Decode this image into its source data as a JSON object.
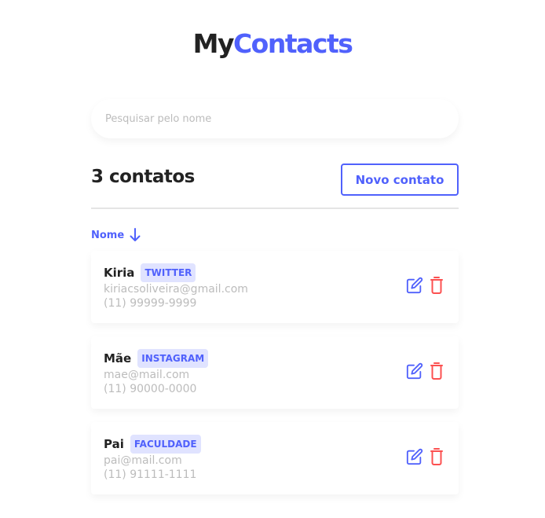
{
  "logo": {
    "part1": "My",
    "part2": "Contacts"
  },
  "search": {
    "placeholder": "Pesquisar pelo nome"
  },
  "header": {
    "count_label": "3 contatos",
    "new_button": "Novo contato"
  },
  "sort": {
    "label": "Nome",
    "direction_icon": "arrow-down-icon"
  },
  "contacts": [
    {
      "name": "Kiria",
      "category": "TWITTER",
      "email": "kiriacsoliveira@gmail.com",
      "phone": "(11) 99999-9999"
    },
    {
      "name": "Mãe",
      "category": "INSTAGRAM",
      "email": "mae@mail.com",
      "phone": "(11) 90000-0000"
    },
    {
      "name": "Pai",
      "category": "FACULDADE",
      "email": "pai@mail.com",
      "phone": "(11) 91111-1111"
    }
  ],
  "colors": {
    "primary": "#5061fc",
    "danger": "#fc5050",
    "text": "#222222",
    "muted": "#bcbcbc",
    "tag_bg": "#e0e3ff"
  },
  "icons": {
    "edit": "edit-icon",
    "delete": "trash-icon"
  }
}
